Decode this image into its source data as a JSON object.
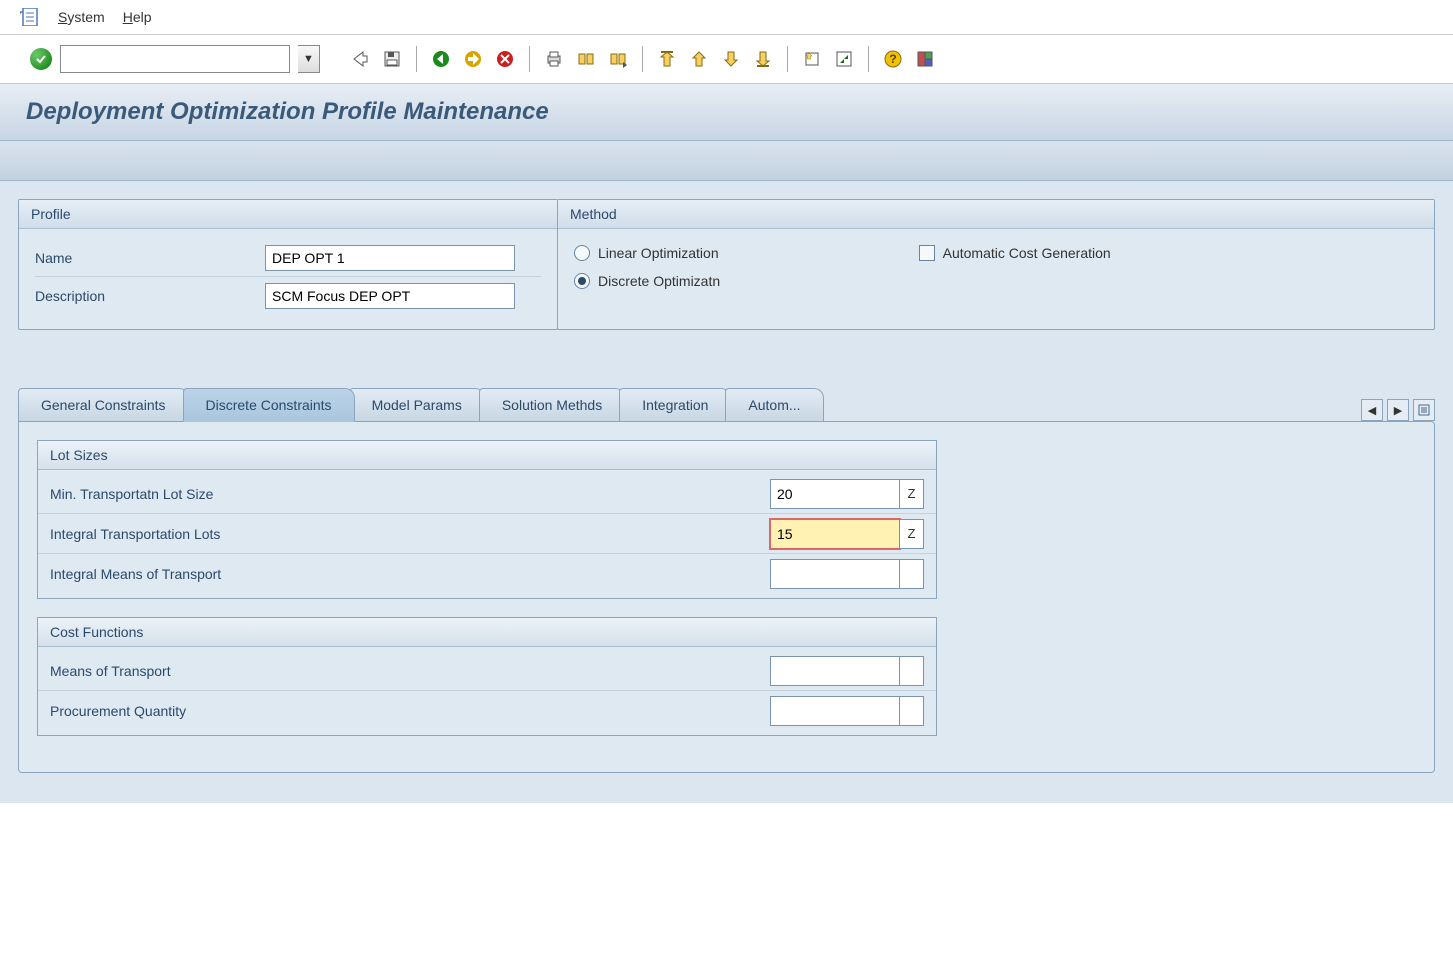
{
  "menubar": {
    "system": "System",
    "help": "Help"
  },
  "title": "Deployment Optimization Profile Maintenance",
  "profile_group": {
    "title": "Profile",
    "name_label": "Name",
    "name_value": "DEP OPT 1",
    "desc_label": "Description",
    "desc_value": "SCM Focus DEP OPT"
  },
  "method_group": {
    "title": "Method",
    "linear": "Linear Optimization",
    "discrete": "Discrete Optimizatn",
    "auto_cost": "Automatic Cost Generation",
    "selected": "discrete",
    "auto_cost_checked": false
  },
  "tabs": {
    "items": [
      {
        "label": "General Constraints"
      },
      {
        "label": "Discrete Constraints"
      },
      {
        "label": "Model Params"
      },
      {
        "label": "Solution Methds"
      },
      {
        "label": "Integration"
      },
      {
        "label": "Autom..."
      }
    ],
    "active_index": 1
  },
  "lot_sizes": {
    "title": "Lot Sizes",
    "rows": [
      {
        "label": "Min. Transportatn Lot Size",
        "value": "20",
        "unit": "Z"
      },
      {
        "label": "Integral Transportation Lots",
        "value": "15",
        "unit": "Z",
        "focused": true
      },
      {
        "label": "Integral Means of Transport",
        "value": "",
        "unit": ""
      }
    ]
  },
  "cost_functions": {
    "title": "Cost Functions",
    "rows": [
      {
        "label": "Means of Transport",
        "value": "",
        "unit": ""
      },
      {
        "label": "Procurement Quantity",
        "value": "",
        "unit": ""
      }
    ]
  }
}
